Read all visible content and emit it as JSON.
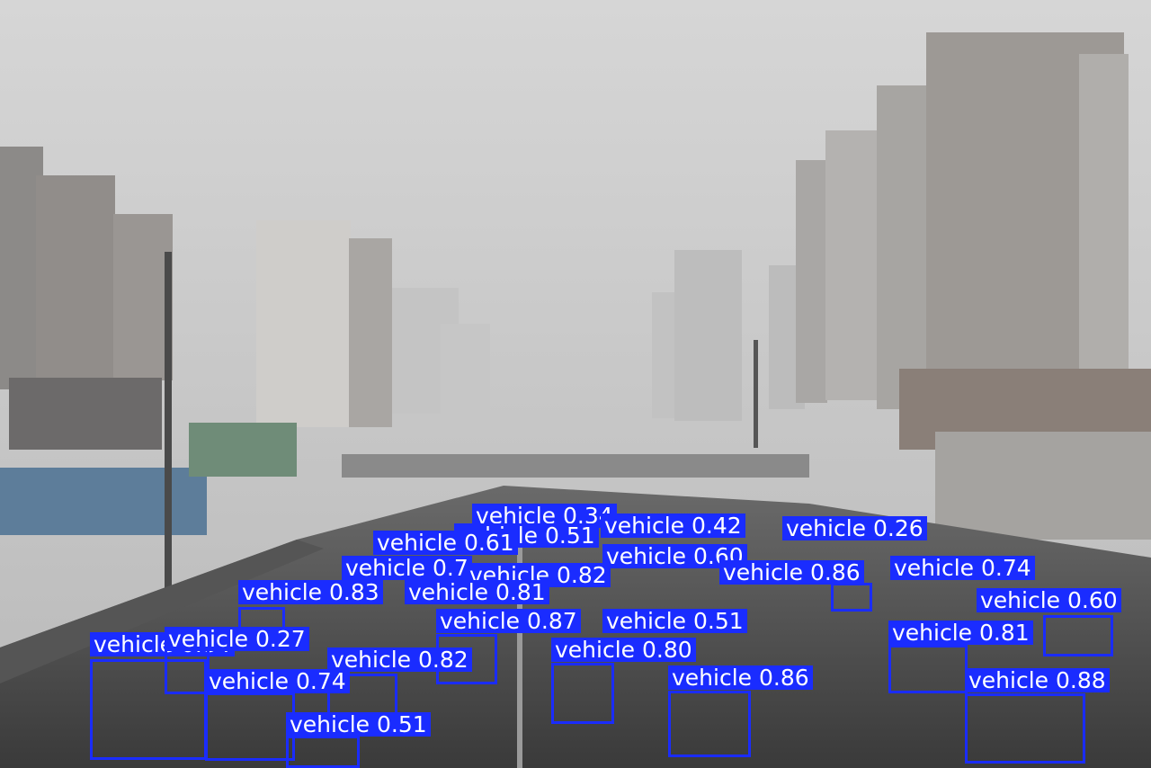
{
  "colors": {
    "box": "#1a2cff",
    "label_text": "#ffffff"
  },
  "detections": [
    {
      "label": "vehicle",
      "score": "0.34"
    },
    {
      "label": "vehicle",
      "score": "0.42"
    },
    {
      "label": "vehicle",
      "score": "0.26"
    },
    {
      "label": "vehicle",
      "score": "0.51"
    },
    {
      "label": "vehicle",
      "score": "0.61"
    },
    {
      "label": "vehicle",
      "score": "0.60"
    },
    {
      "label": "vehicle",
      "score": "0.7"
    },
    {
      "label": "vehicle",
      "score": "0.82"
    },
    {
      "label": "vehicle",
      "score": "0.86"
    },
    {
      "label": "vehicle",
      "score": "0.74"
    },
    {
      "label": "vehicle",
      "score": "0.83"
    },
    {
      "label": "vehicle",
      "score": "0.81"
    },
    {
      "label": "vehicle",
      "score": "0.60"
    },
    {
      "label": "vehicle",
      "score": "0.87"
    },
    {
      "label": "vehicle",
      "score": "0.51"
    },
    {
      "label": "vehicle",
      "score": "0.81"
    },
    {
      "label": "vehicle",
      "score": "0.84"
    },
    {
      "label": "vehicle",
      "score": "0.27"
    },
    {
      "label": "vehicle",
      "score": "0.82"
    },
    {
      "label": "vehicle",
      "score": "0.80"
    },
    {
      "label": "vehicle",
      "score": "0.74"
    },
    {
      "label": "vehicle",
      "score": "0.86"
    },
    {
      "label": "vehicle",
      "score": "0.88"
    },
    {
      "label": "vehicle",
      "score": "0.51"
    }
  ]
}
